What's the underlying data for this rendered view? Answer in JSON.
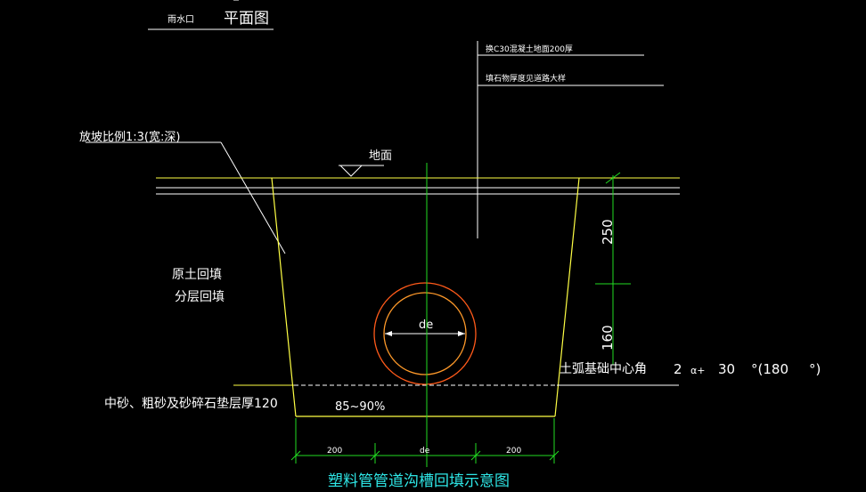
{
  "header": {
    "small_label": "雨水口",
    "title": "平面图"
  },
  "notes": {
    "concrete": "换C30混凝土地面200厚",
    "stone": "填石物厚度见道路大样"
  },
  "labels": {
    "slope": "放坡比例1:3(宽:深)",
    "ground": "地面",
    "backfill_line1": "原土回填",
    "backfill_line2": "分层回填",
    "bedding": "中砂、粗砂及砂碎石垫层厚120",
    "compaction": "85~90%",
    "pipe": "de",
    "base_angle": "土弧基础中心角",
    "formula_1": "2",
    "formula_2": "α+",
    "formula_3": "30",
    "formula_4": "°(180",
    "formula_5": "°)"
  },
  "dimensions": {
    "vertical_top": "250",
    "vertical_bottom": "160",
    "bottom_left": "200",
    "bottom_mid": "de",
    "bottom_right": "200"
  },
  "caption": "塑料管管道沟槽回填示意图",
  "colors": {
    "background": "#000000",
    "text": "#ffffff",
    "trench": "#ffff44",
    "dimension": "#22dd22",
    "pipe_outer": "#ff5a1a",
    "pipe_inner": "#ff9a2a",
    "caption": "#2ee6e6"
  }
}
